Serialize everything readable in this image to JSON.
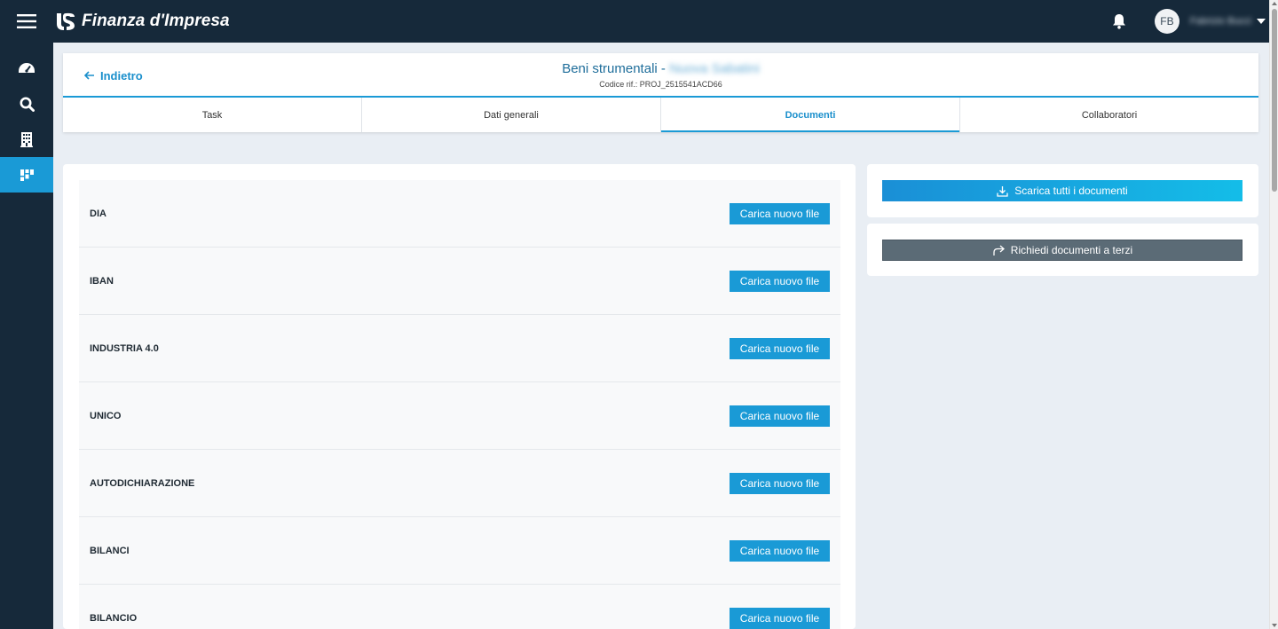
{
  "app": {
    "title": "Finanza d'Impresa",
    "avatar_initials": "FB",
    "username": "Fabrizio Bucci",
    "accent_color": "#1a9ad6",
    "nav_color": "#16293a"
  },
  "sidebar": {
    "items": [
      {
        "icon": "dashboard-gauge-icon",
        "active": false
      },
      {
        "icon": "search-icon",
        "active": false
      },
      {
        "icon": "building-icon",
        "active": false
      },
      {
        "icon": "projects-grid-icon",
        "active": true
      }
    ]
  },
  "header": {
    "back_label": "Indietro",
    "title_prefix": "Beni strumentali - ",
    "title_name": "Nuova Sabatini",
    "subtitle": "Codice rif.: PROJ_2515541ACD66"
  },
  "tabs": [
    {
      "label": "Task",
      "active": false
    },
    {
      "label": "Dati generali",
      "active": false
    },
    {
      "label": "Documenti",
      "active": true
    },
    {
      "label": "Collaboratori",
      "active": false
    }
  ],
  "documents": [
    {
      "name": "DIA",
      "button": "Carica nuovo file"
    },
    {
      "name": "IBAN",
      "button": "Carica nuovo file"
    },
    {
      "name": "INDUSTRIA 4.0",
      "button": "Carica nuovo file"
    },
    {
      "name": "UNICO",
      "button": "Carica nuovo file"
    },
    {
      "name": "AUTODICHIARAZIONE",
      "button": "Carica nuovo file"
    },
    {
      "name": "BILANCI",
      "button": "Carica nuovo file"
    },
    {
      "name": "BILANCIO",
      "button": "Carica nuovo file"
    }
  ],
  "actions": {
    "download_all": "Scarica tutti i documenti",
    "request_third_party": "Richiedi documenti a terzi"
  }
}
